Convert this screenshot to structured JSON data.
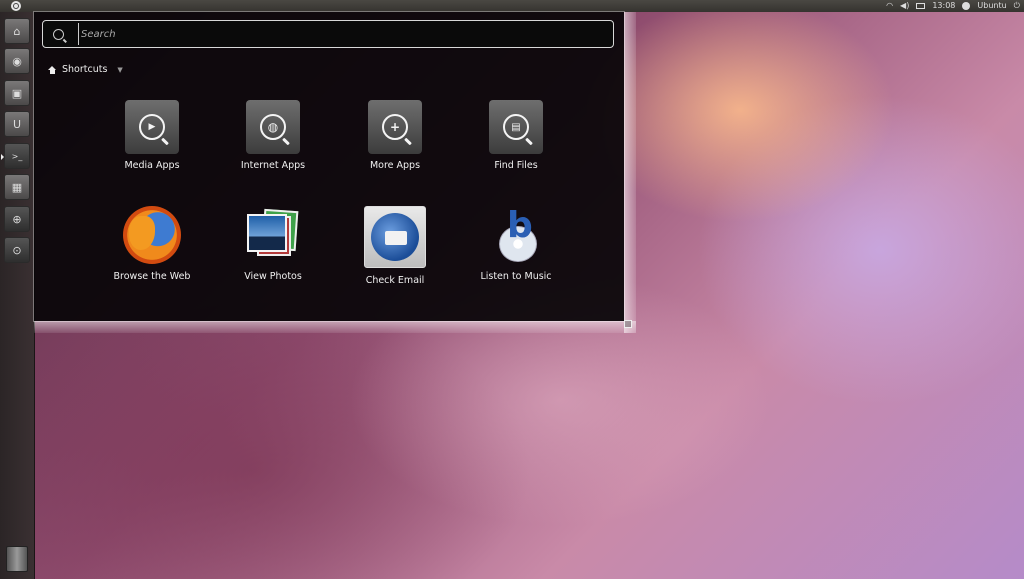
{
  "top_panel": {
    "clock": "13:08",
    "user_name": "Ubuntu",
    "icons": [
      "ubuntu-logo-icon",
      "network-icon",
      "volume-icon",
      "mail-icon",
      "user-icon",
      "power-icon"
    ]
  },
  "launcher": {
    "items": [
      {
        "name": "home-folder",
        "icon": "folder-icon",
        "glyph": "⌂"
      },
      {
        "name": "firefox",
        "icon": "firefox-icon",
        "glyph": "◉"
      },
      {
        "name": "photos",
        "icon": "camera-icon",
        "glyph": "▣"
      },
      {
        "name": "software-center",
        "icon": "bag-icon",
        "glyph": "U"
      },
      {
        "name": "terminal",
        "icon": "terminal-icon",
        "glyph": ">_"
      },
      {
        "name": "workspaces",
        "icon": "workspaces-icon",
        "glyph": "▦"
      },
      {
        "name": "app-lens",
        "icon": "plus-lens-icon",
        "glyph": "⊕"
      },
      {
        "name": "file-lens",
        "icon": "file-lens-icon",
        "glyph": "⊙"
      }
    ],
    "trash_icon": "trash-icon"
  },
  "dash": {
    "search": {
      "placeholder": "Search",
      "value": ""
    },
    "section_label": "Shortcuts",
    "lens_tiles": [
      {
        "label": "Media Apps",
        "icon": "media-lens-icon",
        "glyph": "▶"
      },
      {
        "label": "Internet Apps",
        "icon": "internet-lens-icon",
        "glyph": "◍"
      },
      {
        "label": "More Apps",
        "icon": "more-apps-lens-icon",
        "glyph": "+"
      },
      {
        "label": "Find Files",
        "icon": "files-lens-icon",
        "glyph": "▤"
      }
    ],
    "app_tiles": [
      {
        "label": "Browse the Web",
        "icon": "firefox-icon"
      },
      {
        "label": "View Photos",
        "icon": "photos-icon"
      },
      {
        "label": "Check Email",
        "icon": "thunderbird-icon"
      },
      {
        "label": "Listen to Music",
        "icon": "banshee-icon"
      }
    ]
  }
}
